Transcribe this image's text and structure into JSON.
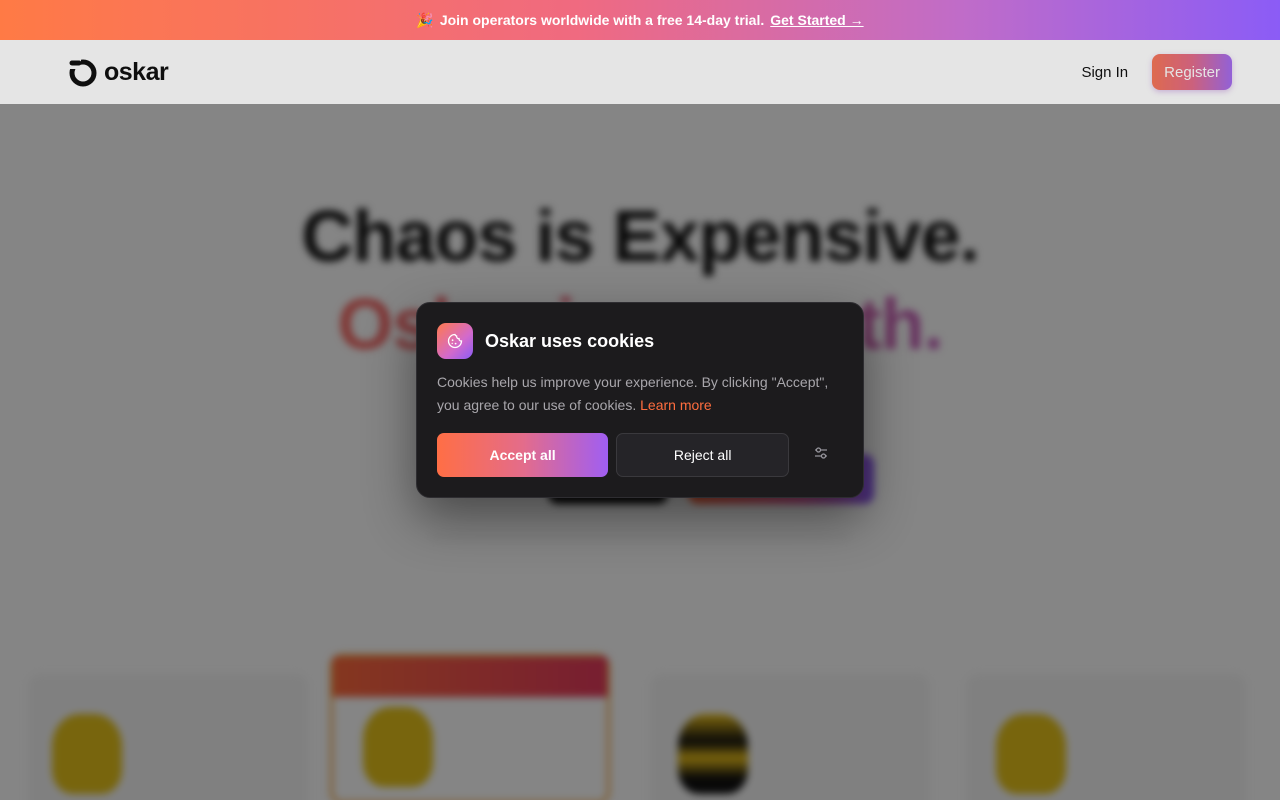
{
  "promo": {
    "emoji": "🎉",
    "text": "Join operators worldwide with a free 14-day trial.",
    "link_label": "Get Started →"
  },
  "header": {
    "logo_text": "oskar",
    "sign_in_label": "Sign In",
    "register_label": "Register"
  },
  "hero": {
    "title_line1": "Chaos is Expensive.",
    "title_line2": "Oskar is ... month."
  },
  "cookie_banner": {
    "title": "Oskar uses cookies",
    "message": "Cookies help us improve your experience. By clicking \"Accept\", you agree to our use of cookies.",
    "learn_more_label": "Learn more",
    "accept_label": "Accept all",
    "reject_label": "Reject all",
    "preferences_icon": "sliders-icon",
    "header_icon": "cookie-icon"
  },
  "colors": {
    "brand_orange": "#ff6e45",
    "brand_purple": "#8b5cf6",
    "modal_bg": "#1c1b1d"
  }
}
